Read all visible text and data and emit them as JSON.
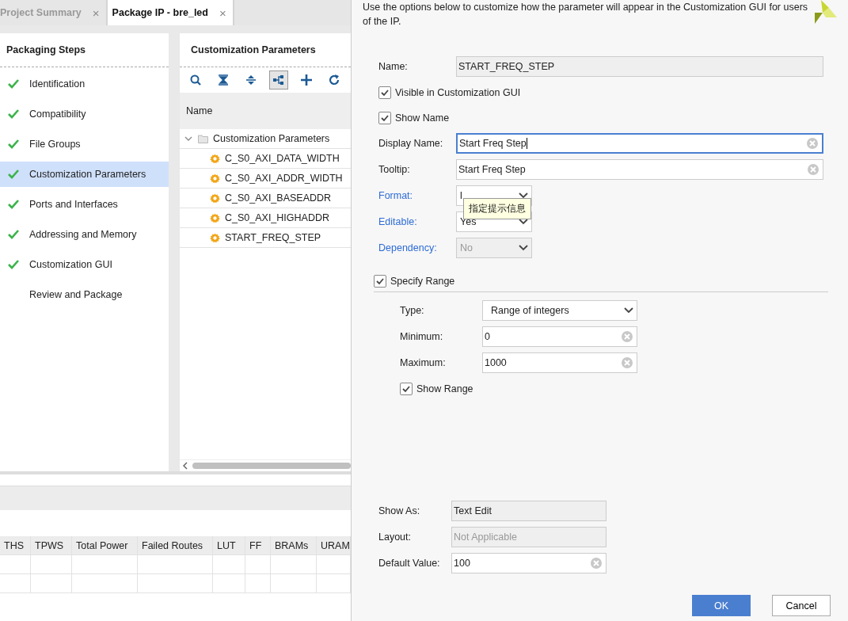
{
  "tabs": [
    {
      "label": "Project Summary",
      "selected": false,
      "close": "×"
    },
    {
      "label": "Package IP - bre_led",
      "selected": true,
      "close": "×"
    }
  ],
  "packaging_steps": {
    "title": "Packaging Steps",
    "items": [
      {
        "label": "Identification",
        "done": true,
        "selected": false
      },
      {
        "label": "Compatibility",
        "done": true,
        "selected": false
      },
      {
        "label": "File Groups",
        "done": true,
        "selected": false
      },
      {
        "label": "Customization Parameters",
        "done": true,
        "selected": true
      },
      {
        "label": "Ports and Interfaces",
        "done": true,
        "selected": false
      },
      {
        "label": "Addressing and Memory",
        "done": true,
        "selected": false
      },
      {
        "label": "Customization GUI",
        "done": true,
        "selected": false
      },
      {
        "label": "Review and Package",
        "done": false,
        "selected": false
      }
    ]
  },
  "parameters_panel": {
    "title": "Customization Parameters",
    "toolbar": [
      {
        "kind": "search",
        "selected": false
      },
      {
        "kind": "collapse",
        "selected": false
      },
      {
        "kind": "expand",
        "selected": false
      },
      {
        "kind": "hierarchy",
        "selected": true
      },
      {
        "kind": "add",
        "selected": false
      },
      {
        "kind": "refresh",
        "selected": false
      }
    ],
    "column": "Name",
    "tree": [
      {
        "label": "Customization Parameters",
        "expanded": true,
        "children": [
          {
            "label": "C_S0_AXI_DATA_WIDTH"
          },
          {
            "label": "C_S0_AXI_ADDR_WIDTH"
          },
          {
            "label": "C_S0_AXI_BASEADDR"
          },
          {
            "label": "C_S0_AXI_HIGHADDR"
          },
          {
            "label": "START_FREQ_STEP"
          }
        ]
      }
    ]
  },
  "results_table": {
    "columns": [
      "THS",
      "TPWS",
      "Total Power",
      "Failed Routes",
      "LUT",
      "FF",
      "BRAMs",
      "URAM"
    ]
  },
  "dialog": {
    "description": "Use the options below to customize how the parameter will appear in the Customization GUI for users of the IP.",
    "name": {
      "label": "Name:",
      "value": "START_FREQ_STEP"
    },
    "visible_in_gui": {
      "label": "Visible in Customization GUI",
      "checked": true
    },
    "show_name": {
      "label": "Show Name",
      "checked": true
    },
    "fields": [
      {
        "kind": "text",
        "label": "Display Name:",
        "value": "Start Freq Step",
        "focused": true,
        "link": false
      },
      {
        "kind": "text",
        "label": "Tooltip:",
        "value": "Start Freq Step",
        "focused": false,
        "link": false
      },
      {
        "kind": "combo",
        "label": "Format:",
        "value": "l",
        "disabled": false,
        "link": true
      },
      {
        "kind": "combo",
        "label": "Editable:",
        "value": "Yes",
        "disabled": false,
        "link": true
      },
      {
        "kind": "combo",
        "label": "Dependency:",
        "value": "No",
        "disabled": true,
        "link": true
      }
    ],
    "tooltip": "指定提示信息",
    "specify_range": {
      "label": "Specify Range",
      "checked": true
    },
    "range": [
      {
        "kind": "combo",
        "label": "Type:",
        "value": "Range of integers"
      },
      {
        "kind": "text",
        "label": "Minimum:",
        "value": "0"
      },
      {
        "kind": "text",
        "label": "Maximum:",
        "value": "1000"
      }
    ],
    "show_range": {
      "label": "Show Range",
      "checked": true
    },
    "display": [
      {
        "kind": "readonly",
        "label": "Show As:",
        "value": "Text Edit",
        "disabled": false
      },
      {
        "kind": "readonly",
        "label": "Layout:",
        "value": "Not Applicable",
        "disabled": true
      },
      {
        "kind": "text",
        "label": "Default Value:",
        "value": "100",
        "disabled": false
      }
    ],
    "buttons": [
      {
        "label": "OK",
        "primary": true
      },
      {
        "label": "Cancel",
        "primary": false
      }
    ]
  }
}
